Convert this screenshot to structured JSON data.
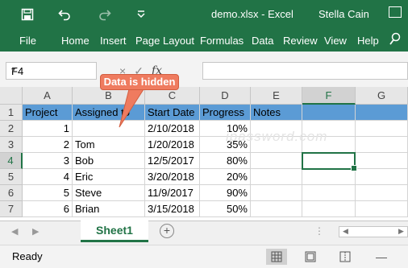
{
  "window": {
    "title": "demo.xlsx  -  Excel",
    "user": "Stella Cain",
    "icons": [
      "save-icon",
      "undo-icon",
      "redo-icon",
      "customize-icon"
    ]
  },
  "ribbon": {
    "tabs": [
      "File",
      "Home",
      "Insert",
      "Page Layout",
      "Formulas",
      "Data",
      "Review",
      "View",
      "Help"
    ]
  },
  "formula_bar": {
    "name_box": "F4",
    "cancel_symbol": "×",
    "enter_symbol": "✓",
    "fx_label": "fx",
    "formula": ""
  },
  "grid": {
    "columns": [
      "A",
      "B",
      "C",
      "D",
      "E",
      "F",
      "G"
    ],
    "rows": [
      "1",
      "2",
      "3",
      "4",
      "5",
      "6",
      "7"
    ],
    "active_column": "F",
    "active_row": "4",
    "header": [
      "Project",
      "Assigned to",
      "Start Date",
      "Progress",
      "Notes"
    ],
    "data": [
      [
        "1",
        "",
        "2/10/2018",
        "10%"
      ],
      [
        "2",
        "Tom",
        "1/20/2018",
        "35%"
      ],
      [
        "3",
        "Bob",
        "12/5/2017",
        "80%"
      ],
      [
        "4",
        "Eric",
        "3/20/2018",
        "20%"
      ],
      [
        "5",
        "Steve",
        "11/9/2017",
        "90%"
      ],
      [
        "6",
        "Brian",
        "3/15/2018",
        "50%"
      ]
    ],
    "header_fill": "#5b9bd5"
  },
  "callout": {
    "text": "Data is hidden",
    "color": "#ef7b5f"
  },
  "watermark": "ipassword.com",
  "sheet_tabs": {
    "active": "Sheet1",
    "add_symbol": "+"
  },
  "status": {
    "text": "Ready"
  },
  "colors": {
    "excel_green": "#217346"
  }
}
